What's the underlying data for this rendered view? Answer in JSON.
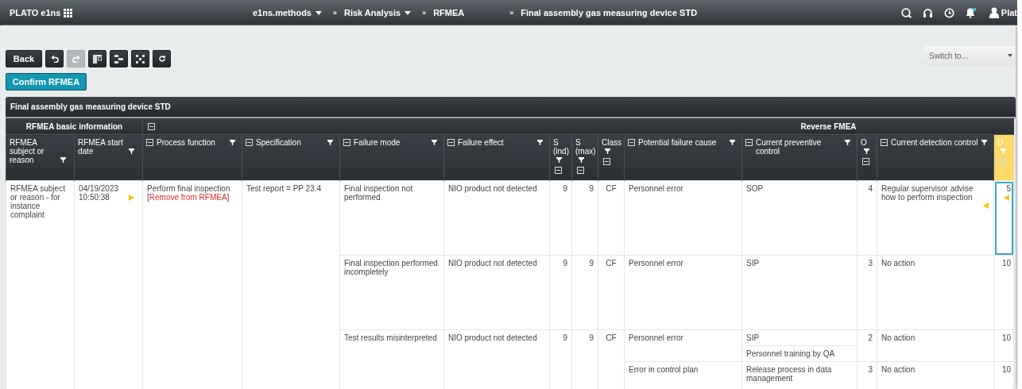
{
  "top_bar": {
    "app_name": "PLATO e1ns",
    "separator": "»",
    "breadcrumbs": [
      {
        "label": "e1ns.methods",
        "dropdown": true
      },
      {
        "label": "Risk Analysis",
        "dropdown": true
      },
      {
        "label": "RFMEA",
        "dropdown": false
      },
      {
        "label": "Final assembly gas measuring device STD",
        "dropdown": false
      }
    ],
    "notification_dot": true,
    "user": "Plat"
  },
  "toolbar": {
    "back": "Back",
    "undo_disabled": false,
    "redo_disabled": true,
    "confirm": "Confirm RFMEA",
    "switch_placeholder": "Switch to..."
  },
  "table": {
    "title": "Final assembly gas measuring device STD",
    "groups": [
      {
        "label": "RFMEA basic information",
        "collapsible": false
      },
      {
        "label": "Reverse FMEA",
        "collapsible": true
      }
    ],
    "columns": [
      {
        "label": "RFMEA subject or reason",
        "kind": "plain",
        "highlighted": false
      },
      {
        "label": "RFMEA start date",
        "kind": "plain",
        "highlighted": false
      },
      {
        "label": "Process function",
        "kind": "inline",
        "highlighted": false
      },
      {
        "label": "Specification",
        "kind": "inline",
        "highlighted": false
      },
      {
        "label": "Failure mode",
        "kind": "inline",
        "highlighted": false
      },
      {
        "label": "Failure effect",
        "kind": "inline",
        "highlighted": false
      },
      {
        "label": "S (ind)",
        "kind": "stacked",
        "highlighted": false
      },
      {
        "label": "S (max)",
        "kind": "stacked",
        "highlighted": false
      },
      {
        "label": "Class",
        "kind": "stacked",
        "highlighted": false
      },
      {
        "label": "Potential failure cause",
        "kind": "inline",
        "highlighted": false
      },
      {
        "label": "Current preventive control",
        "kind": "inline",
        "highlighted": false
      },
      {
        "label": "O",
        "kind": "stacked",
        "highlighted": false
      },
      {
        "label": "Current detection control",
        "kind": "inline",
        "highlighted": false
      },
      {
        "label": "D",
        "kind": "stacked",
        "highlighted": true
      }
    ],
    "subject": "RFMEA subject or reason - for instance complaint",
    "start_date": "04/19/2023 10:50:38",
    "start_date_marker": true,
    "process_function": "Perform final inspection",
    "remove_link": {
      "before": "[",
      "label": "Remove from RFMEA",
      "after": "]"
    },
    "specification": "Test report = PP 23.4",
    "failure_modes": [
      {
        "mode": "Final inspection not performed",
        "effect": "NIO product not detected",
        "s_ind": "9",
        "s_max": "9",
        "class": "CF",
        "causes": [
          {
            "cause": "Personnel error",
            "preventive": [
              "SOP"
            ],
            "o": "4",
            "detection": "Regular supervisor advise how to perform inspection",
            "detection_marker": true,
            "d": "5",
            "d_marker": true,
            "d_selected": true
          }
        ]
      },
      {
        "mode": "Final inspection performed incompletely",
        "effect": "NIO product not detected",
        "s_ind": "9",
        "s_max": "9",
        "class": "CF",
        "causes": [
          {
            "cause": "Personnel error",
            "preventive": [
              "SIP"
            ],
            "o": "3",
            "detection": "No action",
            "detection_marker": false,
            "d": "10",
            "d_marker": false,
            "d_selected": false
          }
        ]
      },
      {
        "mode": "Test results misinterpreted",
        "effect": "NIO product not detected",
        "s_ind": "9",
        "s_max": "9",
        "class": "CF",
        "causes": [
          {
            "cause": "Personnel error",
            "preventive": [
              "SIP",
              "Personnel training by QA"
            ],
            "o": "2",
            "detection": "No action",
            "detection_marker": false,
            "d": "10",
            "d_marker": false,
            "d_selected": false
          },
          {
            "cause": "Error in control plan",
            "preventive": [
              "Release process in data management"
            ],
            "o": "3",
            "detection": "No action",
            "detection_marker": false,
            "d": "10",
            "d_marker": false,
            "d_selected": false
          }
        ]
      }
    ]
  }
}
